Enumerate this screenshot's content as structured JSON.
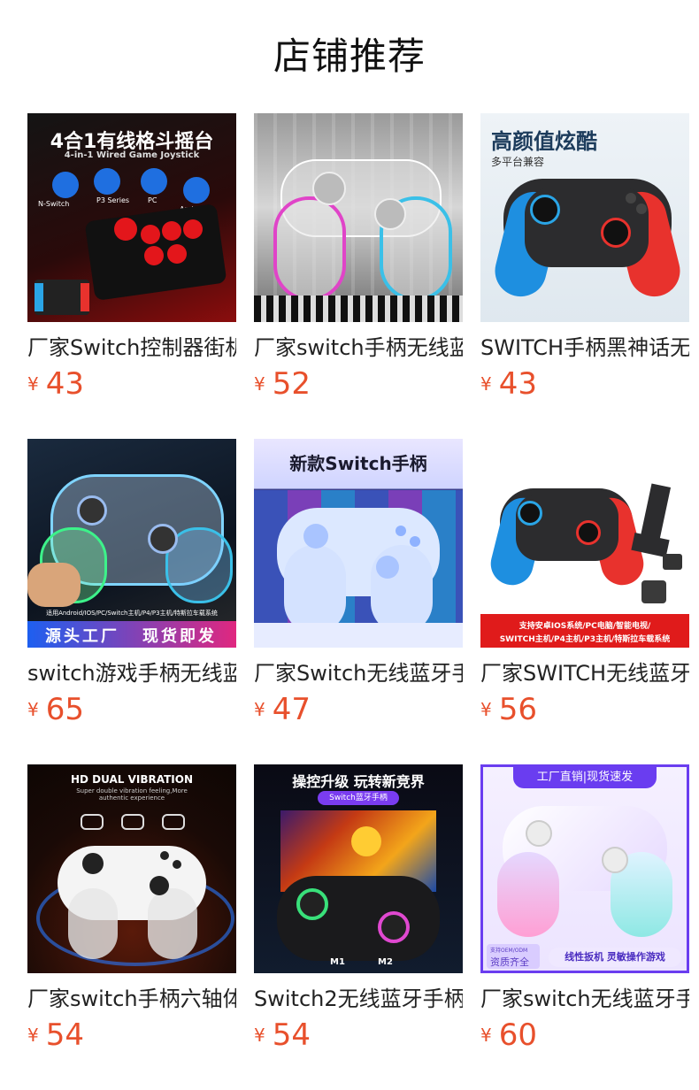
{
  "page": {
    "title": "店铺推荐"
  },
  "currency_symbol": "¥",
  "products": [
    {
      "name": "厂家Switch控制器街机",
      "price": "43",
      "image_text": [
        "4合1有线格斗摇台",
        "4-in-1 Wired Game Joystick",
        "N-Switch",
        "P3 Series",
        "PC",
        "Android"
      ]
    },
    {
      "name": "厂家switch手柄无线蓝牙",
      "price": "52",
      "image_text": []
    },
    {
      "name": "SWITCH手柄黑神话无线",
      "price": "43",
      "image_text": [
        "高颜值炫酷",
        "多平台兼容"
      ]
    },
    {
      "name": "switch游戏手柄无线蓝牙",
      "price": "65",
      "image_text": [
        "适用Android/IOS/PC/Switch主机/P4/P3主机/特斯拉车载系统",
        "源头工厂",
        "现货即发"
      ]
    },
    {
      "name": "厂家Switch无线蓝牙手柄",
      "price": "47",
      "image_text": [
        "新款Switch手柄"
      ]
    },
    {
      "name": "厂家SWITCH无线蓝牙手柄",
      "price": "56",
      "image_text": [
        "支持安卓IOS系统/PC电脑/智能电视/",
        "SWITCH主机/P4主机/P3主机/特斯拉车载系统"
      ]
    },
    {
      "name": "厂家switch手柄六轴体感",
      "price": "54",
      "image_text": [
        "HD DUAL VIBRATION",
        "Super double vibration feeling,More authentic experience"
      ]
    },
    {
      "name": "Switch2无线蓝牙手柄",
      "price": "54",
      "image_text": [
        "操控升级 玩转新竞界",
        "Switch蓝牙手柄",
        "M1",
        "M2"
      ]
    },
    {
      "name": "厂家switch无线蓝牙手柄",
      "price": "60",
      "image_text": [
        "工厂直销|现货速发",
        "支持OEM/ODM",
        "资质齐全",
        "线性扳机 灵敏操作游戏"
      ]
    }
  ]
}
